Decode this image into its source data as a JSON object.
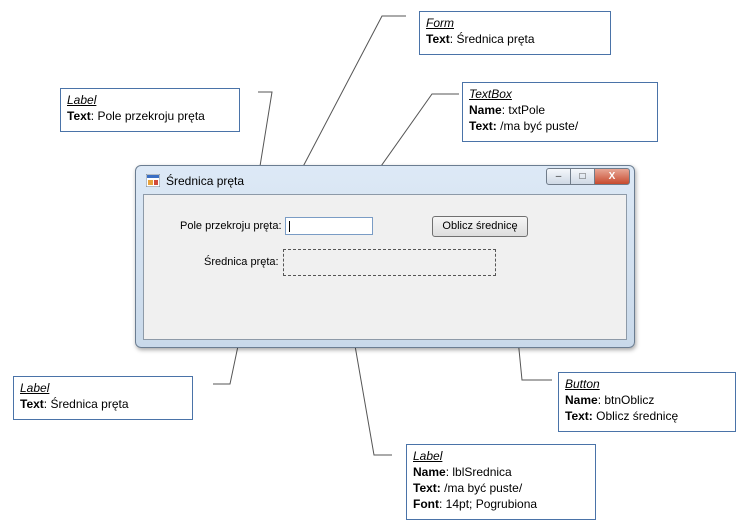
{
  "window": {
    "title": "Średnica pręta",
    "controls": {
      "minimize": "–",
      "maximize": "□",
      "close": "X"
    }
  },
  "form": {
    "label_pole": "Pole przekroju pręta:",
    "label_srednica": "Średnica pręta:",
    "button": "Oblicz średnicę"
  },
  "callouts": {
    "form": {
      "type": "Form",
      "text_key": "Text",
      "text_val": ": Średnica pręta"
    },
    "label_pole": {
      "type": "Label",
      "text_key": "Text",
      "text_val": ": Pole przekroju pręta"
    },
    "textbox": {
      "type": "TextBox",
      "name_key": "Name",
      "name_val": ": txtPole",
      "text_key": "Text:",
      "text_val": " /ma być puste/"
    },
    "label_srednica": {
      "type": "Label",
      "text_key": "Text",
      "text_val": ": Średnica pręta"
    },
    "button": {
      "type": "Button",
      "name_key": "Name",
      "name_val": ": btnOblicz",
      "text_key": "Text:",
      "text_val": " Oblicz średnicę"
    },
    "label_result": {
      "type": "Label",
      "name_key": "Name",
      "name_val": ": lblSrednica",
      "text_key": "Text:",
      "text_val": " /ma być puste/",
      "font_key": "Font",
      "font_val": ": 14pt; Pogrubiona"
    }
  },
  "colors": {
    "callout_border": "#4a73a8",
    "line": "#555555"
  }
}
